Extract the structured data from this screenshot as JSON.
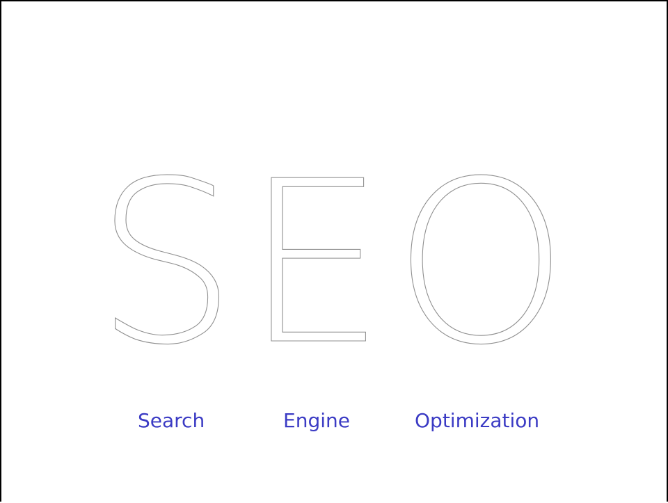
{
  "logo": {
    "text": "SEO"
  },
  "words": {
    "first": "Search",
    "second": "Engine",
    "third": "Optimization"
  },
  "colors": {
    "frame": "#000000",
    "logo_outline": "#8f8f8f",
    "word_text": "#3b3bc4",
    "background": "#ffffff"
  }
}
